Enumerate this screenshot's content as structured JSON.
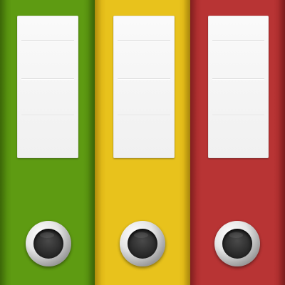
{
  "icon": {
    "name": "binders-icon",
    "binders": [
      {
        "name": "binder-green",
        "color": "#5e9b12",
        "color_dark": "#4a7e0a"
      },
      {
        "name": "binder-yellow",
        "color": "#e8c21c",
        "color_dark": "#d4aa10"
      },
      {
        "name": "binder-red",
        "color": "#b83434",
        "color_dark": "#9e2626"
      }
    ]
  }
}
